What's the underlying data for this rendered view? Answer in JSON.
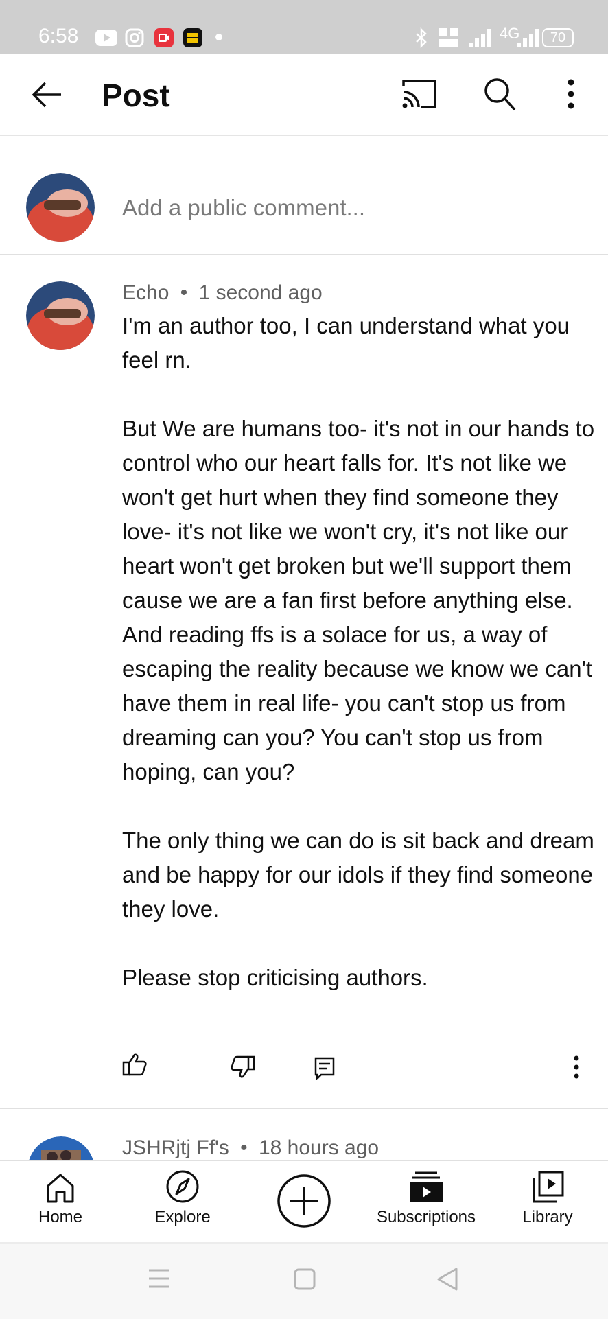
{
  "status_bar": {
    "time": "6:58",
    "network_label": "4G",
    "battery": "70",
    "icons": [
      "youtube-icon",
      "instagram-icon",
      "recorder-icon",
      "app-icon",
      "dot-icon",
      "bluetooth-icon",
      "volte-icon",
      "signal-icon",
      "signal-4g-icon",
      "battery-icon"
    ]
  },
  "header": {
    "title": "Post",
    "icons": [
      "back-arrow-icon",
      "cast-icon",
      "search-icon",
      "more-vert-icon"
    ]
  },
  "comment_input": {
    "placeholder": "Add a public comment..."
  },
  "comments": [
    {
      "author": "Echo",
      "separator": "•",
      "time": "1 second ago",
      "paragraphs": [
        "I'm an author too, I can understand what you feel rn.",
        "",
        "But We are humans too- it's not in our hands to control who our heart falls for. It's not like we won't get hurt when they find someone they love- it's not like we won't cry, it's not like our heart won't get broken but we'll support them cause we are a fan first before anything else.",
        "And reading ffs is a solace for us, a way of escaping the reality because we know we can't have them in real life- you can't stop us from dreaming can you? You can't stop us from hoping, can you?",
        "",
        "The only thing we can do is sit back and dream and be happy for our idols if they find someone they love.",
        "",
        "Please stop criticising authors."
      ],
      "actions": [
        "thumb-up-icon",
        "thumb-down-icon",
        "reply-icon",
        "more-vert-icon"
      ]
    },
    {
      "author": "JSHRjtj Ff's",
      "separator": "•",
      "time": "18 hours ago"
    }
  ],
  "bottom_nav": {
    "items": [
      {
        "label": "Home",
        "icon": "home-icon"
      },
      {
        "label": "Explore",
        "icon": "compass-icon"
      },
      {
        "label": "",
        "icon": "create-plus-icon"
      },
      {
        "label": "Subscriptions",
        "icon": "subscriptions-icon"
      },
      {
        "label": "Library",
        "icon": "library-icon"
      }
    ]
  },
  "system_nav": {
    "icons": [
      "menu-icon",
      "home-square-icon",
      "back-triangle-icon"
    ]
  },
  "colors": {
    "status_bar_bg": "#cfcfcf",
    "text_primary": "#0f0f0f",
    "text_secondary": "#606060",
    "divider": "#e0e0e0"
  }
}
